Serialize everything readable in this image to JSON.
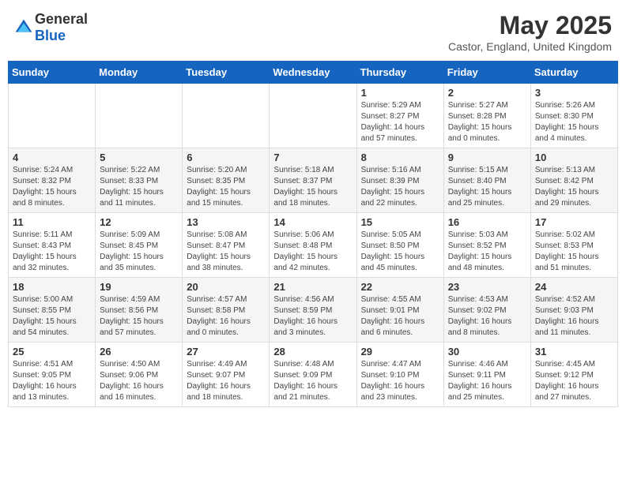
{
  "header": {
    "logo_general": "General",
    "logo_blue": "Blue",
    "title": "May 2025",
    "subtitle": "Castor, England, United Kingdom"
  },
  "weekdays": [
    "Sunday",
    "Monday",
    "Tuesday",
    "Wednesday",
    "Thursday",
    "Friday",
    "Saturday"
  ],
  "weeks": [
    [
      {
        "day": "",
        "info": ""
      },
      {
        "day": "",
        "info": ""
      },
      {
        "day": "",
        "info": ""
      },
      {
        "day": "",
        "info": ""
      },
      {
        "day": "1",
        "info": "Sunrise: 5:29 AM\nSunset: 8:27 PM\nDaylight: 14 hours and 57 minutes."
      },
      {
        "day": "2",
        "info": "Sunrise: 5:27 AM\nSunset: 8:28 PM\nDaylight: 15 hours and 0 minutes."
      },
      {
        "day": "3",
        "info": "Sunrise: 5:26 AM\nSunset: 8:30 PM\nDaylight: 15 hours and 4 minutes."
      }
    ],
    [
      {
        "day": "4",
        "info": "Sunrise: 5:24 AM\nSunset: 8:32 PM\nDaylight: 15 hours and 8 minutes."
      },
      {
        "day": "5",
        "info": "Sunrise: 5:22 AM\nSunset: 8:33 PM\nDaylight: 15 hours and 11 minutes."
      },
      {
        "day": "6",
        "info": "Sunrise: 5:20 AM\nSunset: 8:35 PM\nDaylight: 15 hours and 15 minutes."
      },
      {
        "day": "7",
        "info": "Sunrise: 5:18 AM\nSunset: 8:37 PM\nDaylight: 15 hours and 18 minutes."
      },
      {
        "day": "8",
        "info": "Sunrise: 5:16 AM\nSunset: 8:39 PM\nDaylight: 15 hours and 22 minutes."
      },
      {
        "day": "9",
        "info": "Sunrise: 5:15 AM\nSunset: 8:40 PM\nDaylight: 15 hours and 25 minutes."
      },
      {
        "day": "10",
        "info": "Sunrise: 5:13 AM\nSunset: 8:42 PM\nDaylight: 15 hours and 29 minutes."
      }
    ],
    [
      {
        "day": "11",
        "info": "Sunrise: 5:11 AM\nSunset: 8:43 PM\nDaylight: 15 hours and 32 minutes."
      },
      {
        "day": "12",
        "info": "Sunrise: 5:09 AM\nSunset: 8:45 PM\nDaylight: 15 hours and 35 minutes."
      },
      {
        "day": "13",
        "info": "Sunrise: 5:08 AM\nSunset: 8:47 PM\nDaylight: 15 hours and 38 minutes."
      },
      {
        "day": "14",
        "info": "Sunrise: 5:06 AM\nSunset: 8:48 PM\nDaylight: 15 hours and 42 minutes."
      },
      {
        "day": "15",
        "info": "Sunrise: 5:05 AM\nSunset: 8:50 PM\nDaylight: 15 hours and 45 minutes."
      },
      {
        "day": "16",
        "info": "Sunrise: 5:03 AM\nSunset: 8:52 PM\nDaylight: 15 hours and 48 minutes."
      },
      {
        "day": "17",
        "info": "Sunrise: 5:02 AM\nSunset: 8:53 PM\nDaylight: 15 hours and 51 minutes."
      }
    ],
    [
      {
        "day": "18",
        "info": "Sunrise: 5:00 AM\nSunset: 8:55 PM\nDaylight: 15 hours and 54 minutes."
      },
      {
        "day": "19",
        "info": "Sunrise: 4:59 AM\nSunset: 8:56 PM\nDaylight: 15 hours and 57 minutes."
      },
      {
        "day": "20",
        "info": "Sunrise: 4:57 AM\nSunset: 8:58 PM\nDaylight: 16 hours and 0 minutes."
      },
      {
        "day": "21",
        "info": "Sunrise: 4:56 AM\nSunset: 8:59 PM\nDaylight: 16 hours and 3 minutes."
      },
      {
        "day": "22",
        "info": "Sunrise: 4:55 AM\nSunset: 9:01 PM\nDaylight: 16 hours and 6 minutes."
      },
      {
        "day": "23",
        "info": "Sunrise: 4:53 AM\nSunset: 9:02 PM\nDaylight: 16 hours and 8 minutes."
      },
      {
        "day": "24",
        "info": "Sunrise: 4:52 AM\nSunset: 9:03 PM\nDaylight: 16 hours and 11 minutes."
      }
    ],
    [
      {
        "day": "25",
        "info": "Sunrise: 4:51 AM\nSunset: 9:05 PM\nDaylight: 16 hours and 13 minutes."
      },
      {
        "day": "26",
        "info": "Sunrise: 4:50 AM\nSunset: 9:06 PM\nDaylight: 16 hours and 16 minutes."
      },
      {
        "day": "27",
        "info": "Sunrise: 4:49 AM\nSunset: 9:07 PM\nDaylight: 16 hours and 18 minutes."
      },
      {
        "day": "28",
        "info": "Sunrise: 4:48 AM\nSunset: 9:09 PM\nDaylight: 16 hours and 21 minutes."
      },
      {
        "day": "29",
        "info": "Sunrise: 4:47 AM\nSunset: 9:10 PM\nDaylight: 16 hours and 23 minutes."
      },
      {
        "day": "30",
        "info": "Sunrise: 4:46 AM\nSunset: 9:11 PM\nDaylight: 16 hours and 25 minutes."
      },
      {
        "day": "31",
        "info": "Sunrise: 4:45 AM\nSunset: 9:12 PM\nDaylight: 16 hours and 27 minutes."
      }
    ]
  ]
}
